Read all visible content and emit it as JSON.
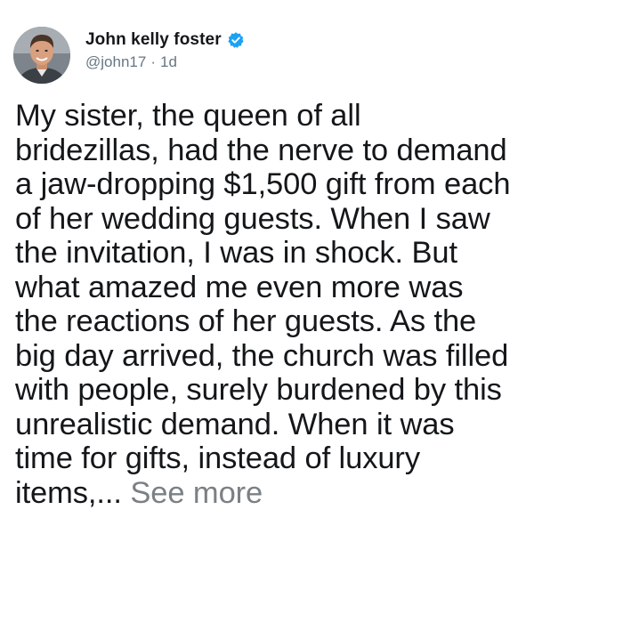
{
  "author": {
    "display_name": "John kelly foster",
    "verified_icon": "verified-badge-icon",
    "handle": "@john17",
    "separator": "·",
    "timestamp": "1d",
    "avatar_icon": "avatar-photo"
  },
  "tweet": {
    "lines": [
      "My sister, the queen of all",
      "bridezillas, had the nerve to demand",
      "a jaw-dropping $1,500 gift from each",
      "of her wedding guests. When I saw",
      "the invitation, I was in shock. But",
      "what amazed me even more was",
      "the reactions of her guests. As the",
      "big day arrived, the church was filled",
      "with people, surely burdened by this",
      "unrealistic demand. When it was",
      "time for gifts, instead of luxury"
    ],
    "last_line_text": "items,... ",
    "see_more_label": "See more"
  },
  "colors": {
    "text": "#14171a",
    "secondary": "#657786",
    "verified": "#1da1f2",
    "see_more": "#7b8085"
  }
}
